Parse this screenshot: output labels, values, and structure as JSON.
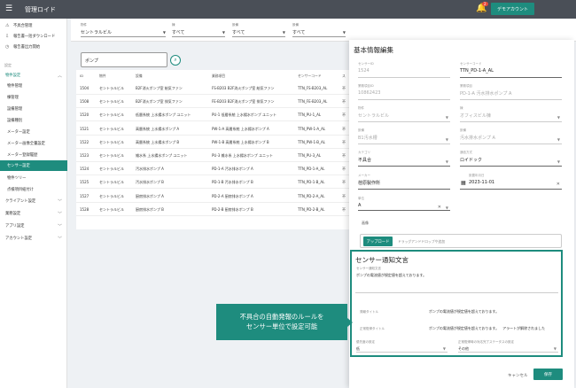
{
  "app": {
    "title": "管理ロイド",
    "demo_button": "デモアカウント",
    "notification_count": "2"
  },
  "sidebar": {
    "top_items": [
      {
        "label": "不具合管理",
        "icon": "alert-icon"
      },
      {
        "label": "報告書一括ダウンロード",
        "icon": "download-icon"
      },
      {
        "label": "報告書出力開始",
        "icon": "clock-icon"
      }
    ],
    "section_label": "設定",
    "group_label": "物件設定",
    "group_items": [
      "物件管理",
      "棟管理",
      "設備管理",
      "設備種別",
      "メーター設定",
      "メーター画像全量設定",
      "メーター登録履歴",
      "センサー設定",
      "物件ツリー",
      "点検項目紐付け"
    ],
    "active_item": "センサー設定",
    "bottom_items": [
      "クライアント設定",
      "業務設定",
      "アプリ設定",
      "アカウント設定"
    ]
  },
  "filters": [
    {
      "label": "物件",
      "value": "セントラルビル"
    },
    {
      "label": "棟",
      "value": "すべて"
    },
    {
      "label": "設備",
      "value": "すべて"
    },
    {
      "label": "設備",
      "value": "すべて"
    }
  ],
  "search": {
    "value": "ポンプ"
  },
  "table": {
    "headers": [
      "ID",
      "物件",
      "設備",
      "業務項目",
      "センサーコード",
      "ス"
    ],
    "rows": [
      [
        "1504",
        "セントラルビル",
        "B2F消火ポンプ室 給気ファン",
        "FS-B203 B2F消火ポンプ室 給気ファン",
        "TTN_FS-B203_AL",
        "不"
      ],
      [
        "1508",
        "セントラルビル",
        "B2F消火ポンプ室 排気ファン",
        "FE-B203 B2F消火ポンプ室 排気ファン",
        "TTN_FE-B203_AL",
        "不"
      ],
      [
        "1520",
        "セントラルビル",
        "低層系統 上水揚水ポンプ ユニット",
        "PU-1 低層系統 上水揚水ポンプ ユニット",
        "TTN_PU-1_AL",
        "不"
      ],
      [
        "1521",
        "セントラルビル",
        "高層系統 上水揚水ポンプ A",
        "PW-1-A 高層系統 上水揚水ポンプ A",
        "TTN_PW-1-A_AL",
        "不"
      ],
      [
        "1522",
        "セントラルビル",
        "高層系統 上水揚水ポンプ B",
        "PW-1-B 高層系統 上水揚水ポンプ B",
        "TTN_PW-1-B_AL",
        "不"
      ],
      [
        "1523",
        "セントラルビル",
        "雑水系 上水揚水ポンプ ユニット",
        "PU-3 雑水系 上水揚水ポンプ ユニット",
        "TTN_PU-3_AL",
        "不"
      ],
      [
        "1524",
        "セントラルビル",
        "汚水排水ポンプ A",
        "PD-1-A 汚水排水ポンプ A",
        "TTN_PD-1-A_AL",
        "不"
      ],
      [
        "1525",
        "セントラルビル",
        "汚水排水ポンプ B",
        "PD-1-B 汚水排水ポンプ B",
        "TTN_PD-1-B_AL",
        "不"
      ],
      [
        "1527",
        "セントラルビル",
        "厨房排水ポンプ A",
        "PD-2-A 厨房排水ポンプ A",
        "TTN_PD-2-A_AL",
        "不"
      ],
      [
        "1528",
        "セントラルビル",
        "厨房排水ポンプ B",
        "PD-2-B 厨房排水ポンプ B",
        "TTN_PD-2-B_AL",
        "不"
      ]
    ]
  },
  "modal": {
    "title": "基本情報編集",
    "fields": [
      {
        "label": "センサーID",
        "value": "1524"
      },
      {
        "label": "センサーコード",
        "value": "TTN_PD-1-A_AL"
      },
      {
        "label": "業務項目ID",
        "value": "10862423"
      },
      {
        "label": "業務項目",
        "value": "PD-1-A 汚水排水ポンプ A"
      },
      {
        "label": "物件",
        "value": "セントラルビル"
      },
      {
        "label": "棟",
        "value": "オフィスビル棟"
      },
      {
        "label": "設備",
        "value": "B1汚水槽"
      },
      {
        "label": "設備",
        "value": "汚水排水ポンプ A"
      },
      {
        "label": "カテゴリ",
        "value": "不具合"
      },
      {
        "label": "通信方式",
        "value": "ロイドック"
      },
      {
        "label": "メーカー",
        "value": "荏原製作所"
      },
      {
        "label": "設置年月日",
        "value": "2023-11-01"
      },
      {
        "label": "単位",
        "value": "A"
      }
    ],
    "image_label": "画像",
    "upload_button": "アップロード",
    "upload_hint": "ドラッグアンドドロップや追加",
    "cancel_button": "キャンセル",
    "save_button": "保存"
  },
  "notify": {
    "title": "センサー通知文言",
    "message_label": "センサー通知文言",
    "message_value": "ポンプの電流値が規定値を超えております。",
    "alert_title_label": "発報タイトル",
    "alert_title_value": "ポンプの電流値が規定値を超えております。",
    "recovery_title_label": "正常復帰タイトル",
    "recovery_title_value": "ポンプの電流値が規定値を超えております。　アラートが解除されました",
    "priority_label": "優先度の設定",
    "priority_value": "低",
    "status_label": "正常復帰時の対応完了ステータスの設定",
    "status_value": "その他"
  },
  "callout": {
    "line1": "不具合の自動発報のルールを",
    "line2": "センサー単位で設定可能"
  },
  "colors": {
    "accent": "#1e8c7e",
    "topbar": "#4a4f57"
  }
}
